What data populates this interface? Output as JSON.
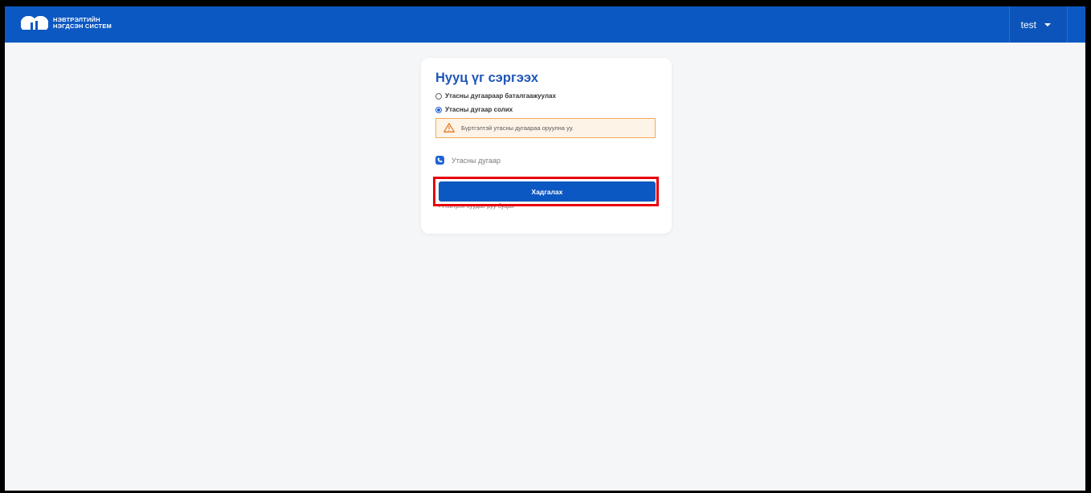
{
  "header": {
    "logo_line1": "НЭВТРЭЛТИЙН",
    "logo_line2": "НЭГДСЭН СИСТЕМ",
    "user_name": "test"
  },
  "form": {
    "title": "Нууц үг сэргээх",
    "options": [
      {
        "label": "Утасны дугаараар баталгаажуулах",
        "checked": false
      },
      {
        "label": "Утасны дугаар солих",
        "checked": true
      }
    ],
    "alert_text": "Бүртгэлтэй утасны дугаараа оруулна уу.",
    "phone_placeholder": "Утасны дугаар",
    "save_label": "Хадгалах",
    "back_link": "< Нэвтрэх хуудас руу буцах"
  },
  "colors": {
    "primary": "#0c58c2",
    "title": "#1f56b8",
    "alert_border": "#f0a85c",
    "alert_bg": "#fdf3e7",
    "highlight": "#e8000a"
  },
  "icons": {
    "logo": "cloud-logo-icon",
    "user_menu": "caret-down-icon",
    "alert": "warning-triangle-icon",
    "phone": "phone-icon"
  }
}
